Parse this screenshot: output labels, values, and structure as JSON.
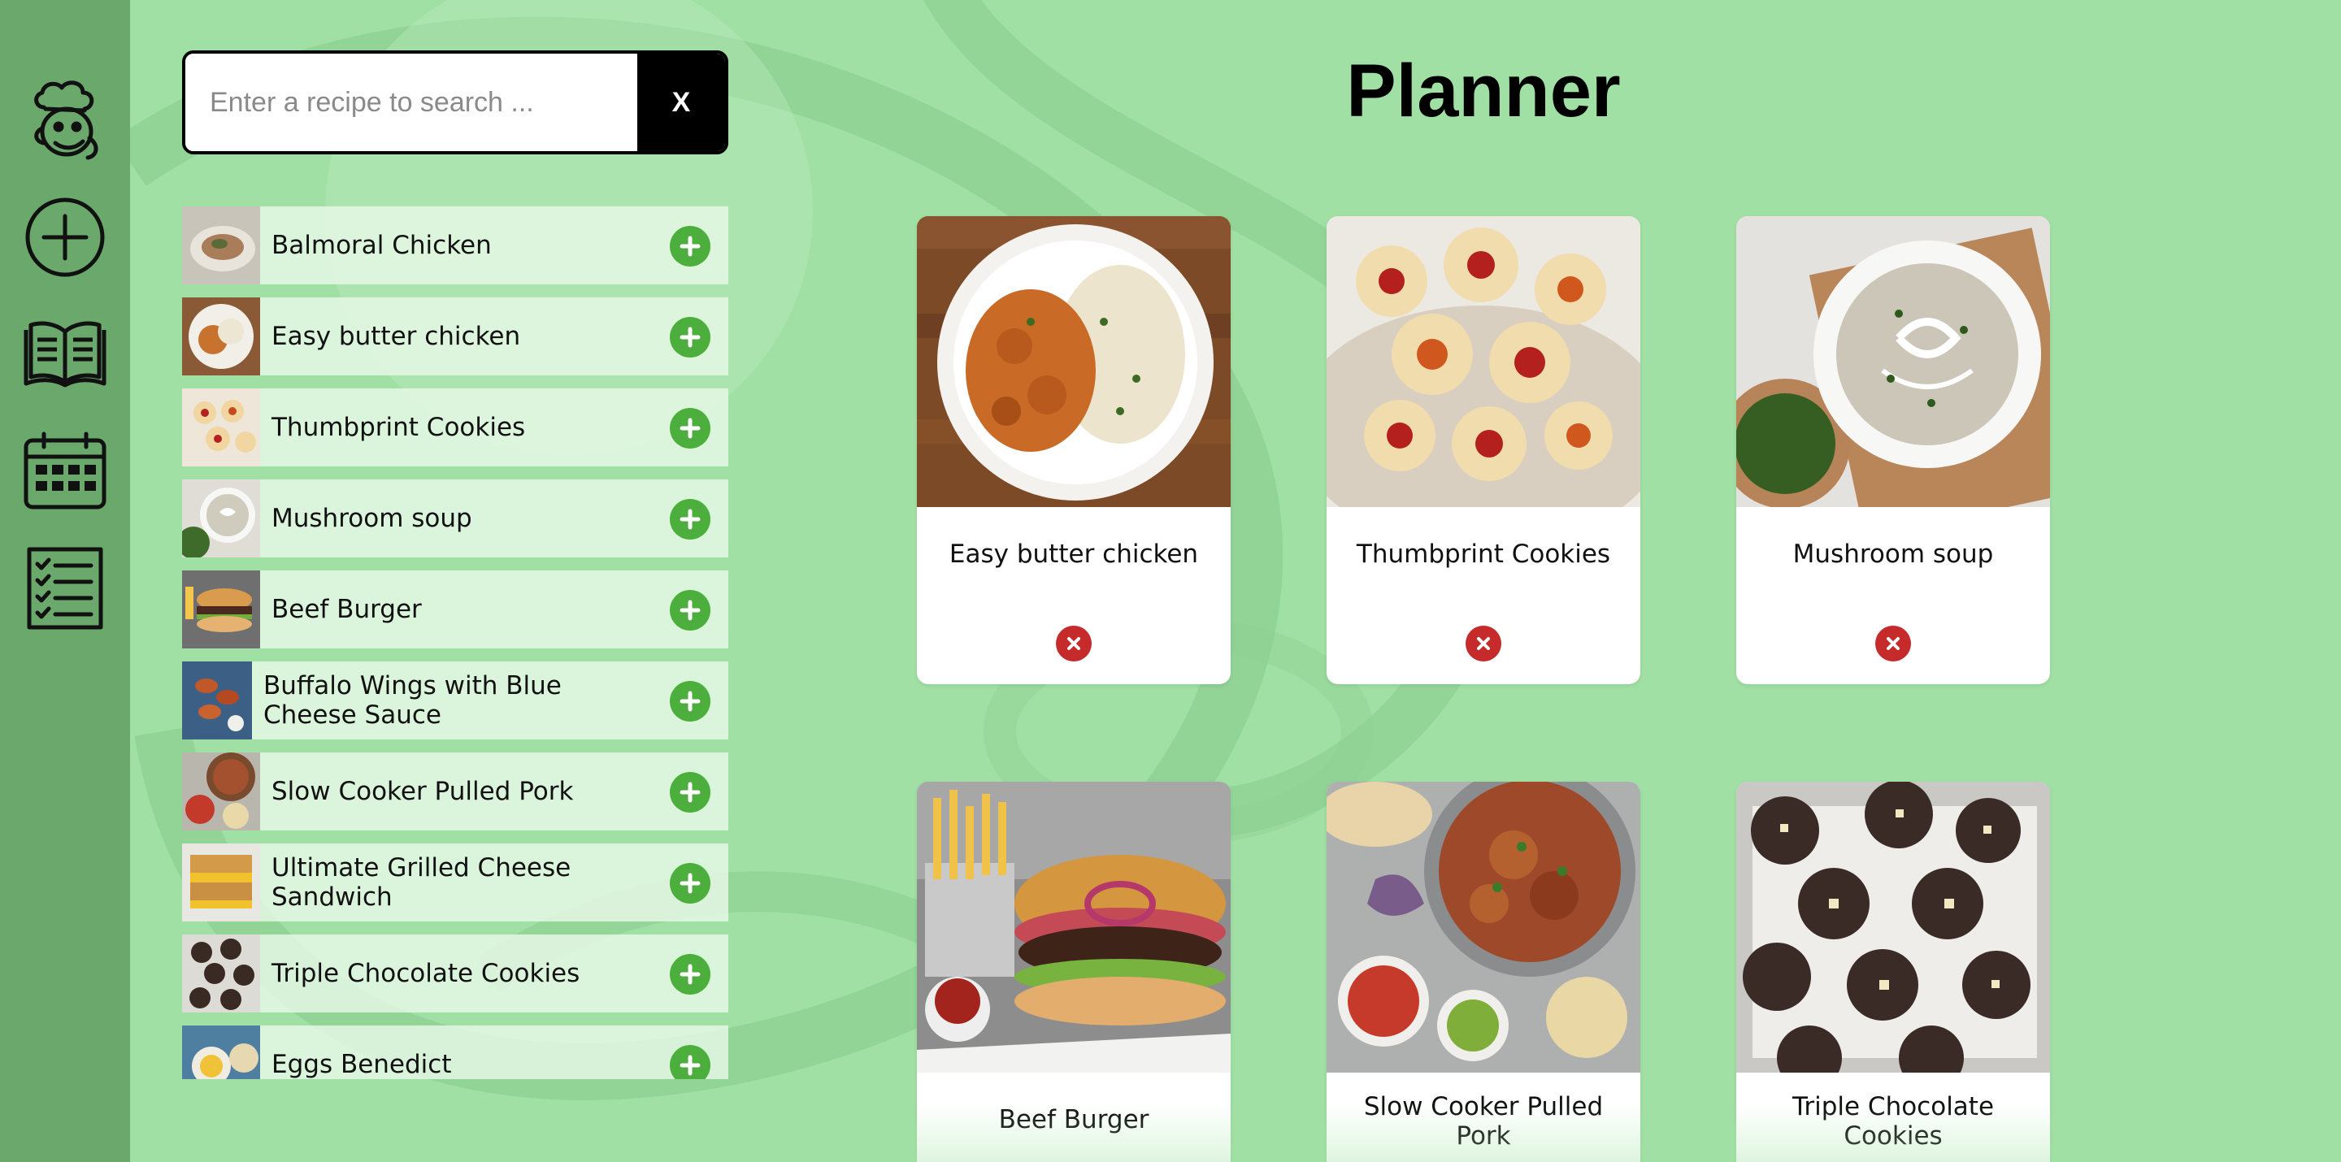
{
  "nav": {
    "items": [
      {
        "name": "chef-logo-icon"
      },
      {
        "name": "add-recipe-icon"
      },
      {
        "name": "recipe-book-icon"
      },
      {
        "name": "calendar-icon"
      },
      {
        "name": "checklist-icon"
      }
    ]
  },
  "search": {
    "placeholder": "Enter a recipe to search ...",
    "value": "",
    "clear_label": "X"
  },
  "recipes": [
    {
      "label": "Balmoral Chicken"
    },
    {
      "label": "Easy butter chicken"
    },
    {
      "label": "Thumbprint Cookies"
    },
    {
      "label": "Mushroom soup"
    },
    {
      "label": "Beef Burger"
    },
    {
      "label": "Buffalo Wings with Blue Cheese Sauce"
    },
    {
      "label": "Slow Cooker Pulled Pork"
    },
    {
      "label": "Ultimate Grilled Cheese Sandwich"
    },
    {
      "label": "Triple Chocolate Cookies"
    },
    {
      "label": "Eggs Benedict"
    }
  ],
  "planner": {
    "title": "Planner",
    "cards": [
      {
        "title": "Easy butter chicken"
      },
      {
        "title": "Thumbprint Cookies"
      },
      {
        "title": "Mushroom soup"
      },
      {
        "title": "Beef Burger"
      },
      {
        "title": "Slow Cooker Pulled Pork"
      },
      {
        "title": "Triple Chocolate Cookies"
      }
    ]
  },
  "colors": {
    "background": "#a1e0a4",
    "sidebar": "#6aa86c",
    "add_button": "#4cae3c",
    "remove_button": "#c62b2b"
  }
}
